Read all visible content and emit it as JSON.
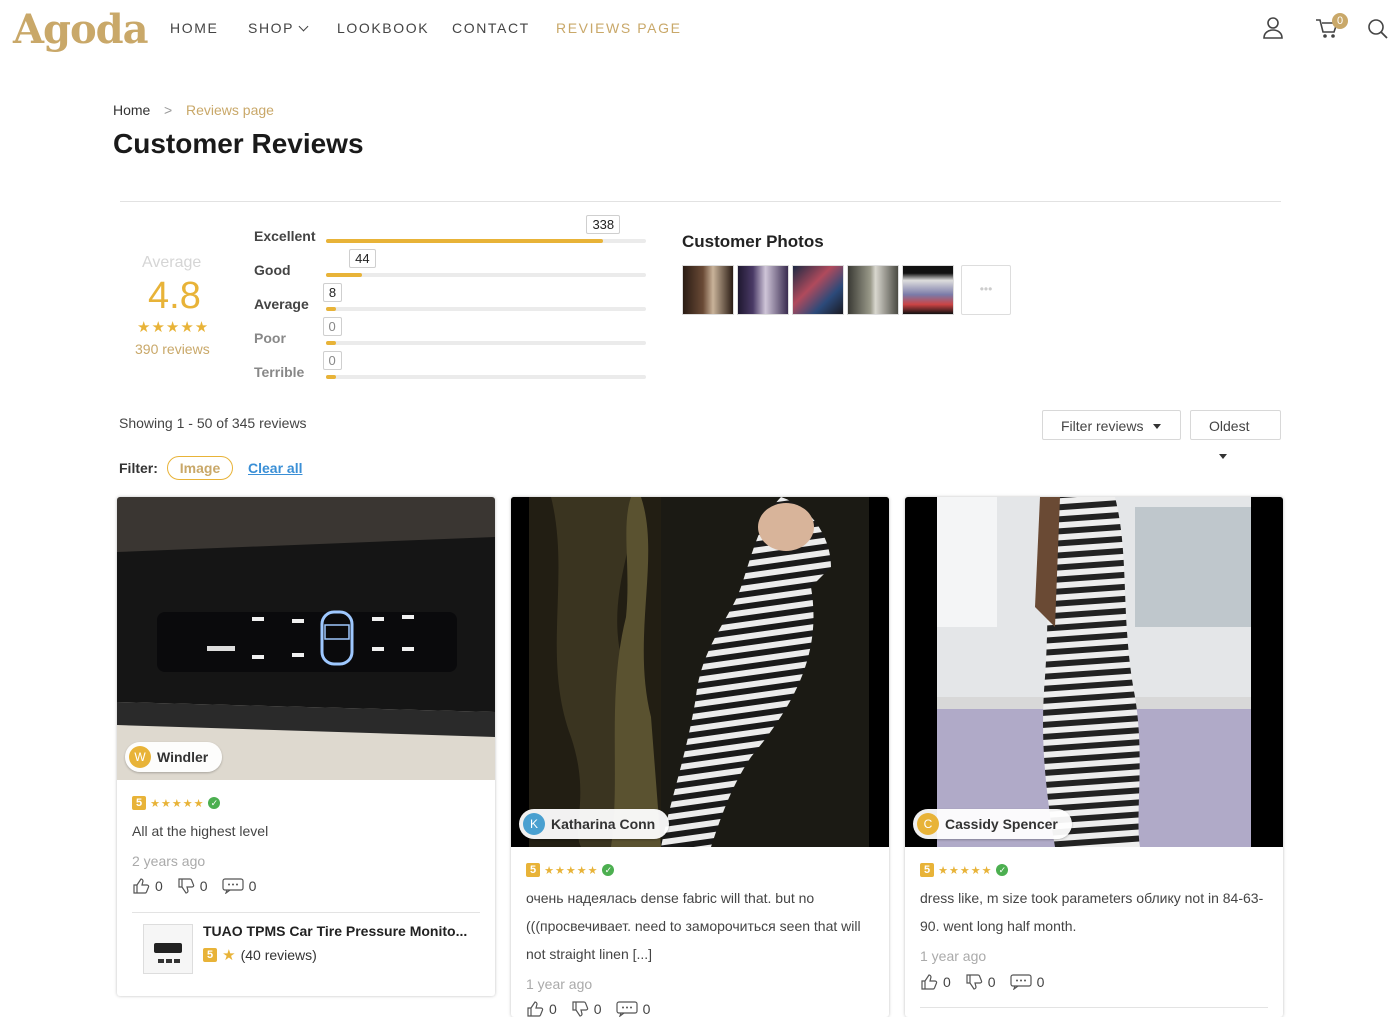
{
  "header": {
    "logo": "Agoda",
    "nav": [
      "HOME",
      "SHOP",
      "LOOKBOOK",
      "CONTACT",
      "REVIEWS PAGE"
    ],
    "cart_count": "0",
    "icons": [
      "user-icon",
      "cart-icon",
      "search-icon"
    ]
  },
  "breadcrumb": {
    "home": "Home",
    "separator": ">",
    "current": "Reviews page"
  },
  "page_title": "Customer Reviews",
  "summary": {
    "average_label": "Average",
    "average_value": "4.8",
    "stars": "★★★★★",
    "total_reviews": "390 reviews",
    "breakdown": [
      {
        "label": "Excellent",
        "count": "338",
        "fraction": 0.867
      },
      {
        "label": "Good",
        "count": "44",
        "fraction": 0.113
      },
      {
        "label": "Average",
        "count": "8",
        "fraction": 0.02
      },
      {
        "label": "Poor",
        "count": "0",
        "fraction": 0.0
      },
      {
        "label": "Terrible",
        "count": "0",
        "fraction": 0.0
      }
    ]
  },
  "customer_photos": {
    "title": "Customer Photos",
    "more": "•••"
  },
  "listing": {
    "showing": "Showing 1 - 50 of 345 reviews",
    "filter_dropdown": "Filter reviews",
    "sort_dropdown": "Oldest",
    "filter_label": "Filter:",
    "filter_chip": "Image",
    "clear_all": "Clear all"
  },
  "reviews": [
    {
      "initial": "W",
      "name": "Windler",
      "avatar_color": "#e8b338",
      "score": "5",
      "text": "All at the highest level",
      "time": "2 years ago",
      "likes": "0",
      "dislikes": "0",
      "comments": "0",
      "product": {
        "name": "TUAO TPMS Car Tire Pressure Monito...",
        "score": "5",
        "reviews": "(40 reviews)"
      }
    },
    {
      "initial": "K",
      "name": "Katharina Conn",
      "avatar_color": "#4aa0d0",
      "score": "5",
      "text": "очень надеялась dense fabric will that. but no (((просвечивает. need to заморочиться seen that will not straight linen [...]",
      "time": "1 year ago",
      "likes": "0",
      "dislikes": "0",
      "comments": "0"
    },
    {
      "initial": "C",
      "name": "Cassidy Spencer",
      "avatar_color": "#e8b338",
      "score": "5",
      "text": "dress like, m size took parameters облику not in 84-63-90. went long half month.",
      "time": "1 year ago",
      "likes": "0",
      "dislikes": "0",
      "comments": "0"
    }
  ]
}
